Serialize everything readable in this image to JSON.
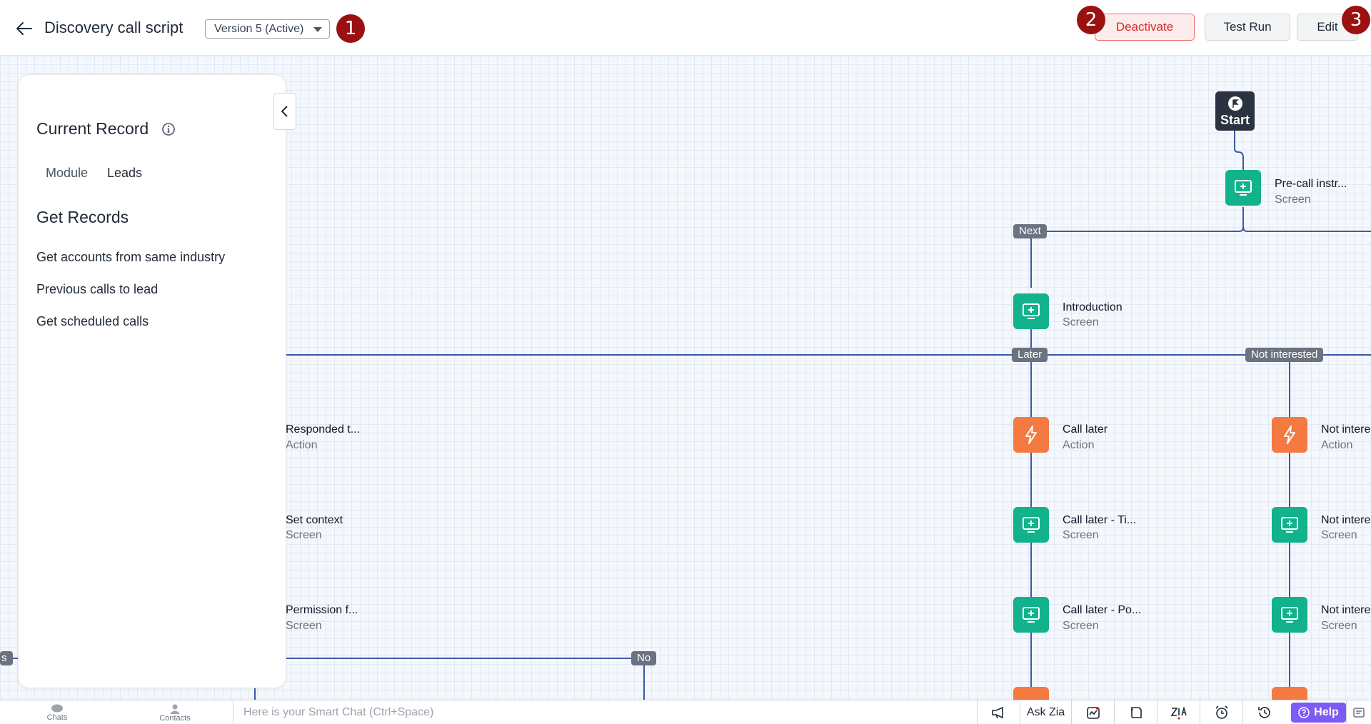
{
  "header": {
    "title": "Discovery call script",
    "version_label": "Version 5 (Active)",
    "badges": [
      "1",
      "2",
      "3"
    ],
    "buttons": {
      "deactivate": "Deactivate",
      "test_run": "Test Run",
      "edit": "Edit"
    }
  },
  "panel": {
    "current_record_title": "Current Record",
    "module_label": "Module",
    "module_value": "Leads",
    "get_records_title": "Get Records",
    "records": [
      "Get accounts from same industry",
      "Previous calls to lead",
      "Get scheduled calls"
    ]
  },
  "flow": {
    "start_label": "Start",
    "chips": {
      "next": "Next",
      "later": "Later",
      "not_interested": "Not interested",
      "no": "No",
      "left_cut": "s"
    },
    "nodes": {
      "pre_call": {
        "title": "Pre-call instr...",
        "type": "Screen"
      },
      "introduction": {
        "title": "Introduction",
        "type": "Screen"
      },
      "responded": {
        "title": "Responded t...",
        "type": "Action"
      },
      "set_context": {
        "title": "Set context",
        "type": "Screen"
      },
      "permission": {
        "title": "Permission f...",
        "type": "Screen"
      },
      "call_later": {
        "title": "Call later",
        "type": "Action"
      },
      "call_later_ti": {
        "title": "Call later - Ti...",
        "type": "Screen"
      },
      "call_later_po": {
        "title": "Call later - Po...",
        "type": "Screen"
      },
      "not_inter_1": {
        "title": "Not intere",
        "type": "Action"
      },
      "not_inter_2": {
        "title": "Not intere",
        "type": "Screen"
      },
      "not_inter_3": {
        "title": "Not intere",
        "type": "Screen"
      }
    }
  },
  "bottombar": {
    "chats": "Chats",
    "contacts": "Contacts",
    "smart_chat_placeholder": "Here is your Smart Chat (Ctrl+Space)",
    "ask_zia": "Ask Zia",
    "help": "Help"
  },
  "colors": {
    "screen_node": "#12b28c",
    "action_node": "#f47a42",
    "connector": "#3b5aa8",
    "badge": "#9b1010",
    "deactivate": "#dc2626",
    "help": "#7c5cf5"
  }
}
